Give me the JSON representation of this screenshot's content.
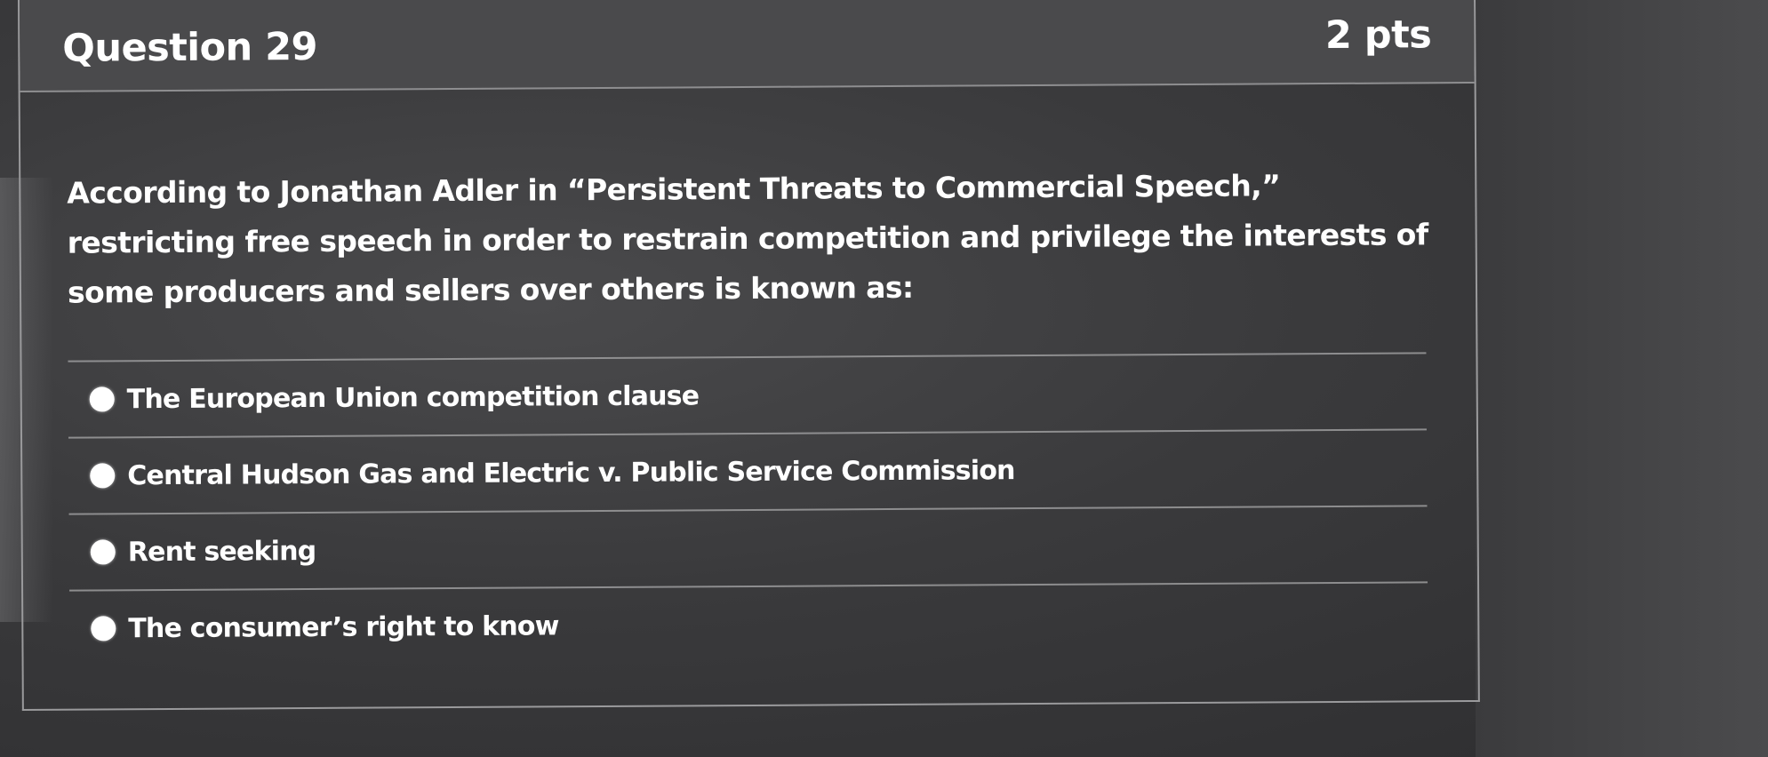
{
  "question": {
    "title": "Question 29",
    "points": "2 pts",
    "text": "According to Jonathan Adler in “Persistent Threats to Commercial Speech,” restricting free speech in order to restrain competition and privilege the interests of some producers and sellers over others is known as:"
  },
  "answers": [
    {
      "label": "The European Union competition clause"
    },
    {
      "label": "Central Hudson Gas and Electric v. Public Service Commission"
    },
    {
      "label": "Rent seeking"
    },
    {
      "label": "The consumer’s right to know"
    }
  ],
  "colors": {
    "background": "#3a3a3c",
    "header": "#4a4a4c",
    "border": "#9a9a9c",
    "text": "#ffffff"
  }
}
